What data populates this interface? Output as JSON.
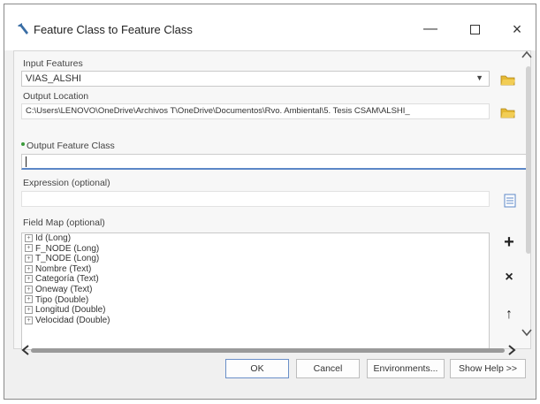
{
  "window": {
    "title": "Feature Class to Feature Class"
  },
  "title_buttons": {
    "minimize": "—",
    "close": "×"
  },
  "params": {
    "input_features": {
      "label": "Input Features",
      "value": "VIAS_ALSHI"
    },
    "output_location": {
      "label": "Output Location",
      "value": "C:\\Users\\LENOVO\\OneDrive\\Archivos T\\OneDrive\\Documentos\\Rvo. Ambiental\\5. Tesis CSAM\\ALSHI_"
    },
    "output_feature_class": {
      "label": "Output Feature Class",
      "value": ""
    },
    "expression": {
      "label": "Expression (optional)",
      "value": ""
    },
    "field_map": {
      "label": "Field Map (optional)",
      "items": [
        "Id (Long)",
        "F_NODE (Long)",
        "T_NODE (Long)",
        "Nombre (Text)",
        "Categoría (Text)",
        "Oneway (Text)",
        "Tipo (Double)",
        "Longitud (Double)",
        "Velocidad (Double)"
      ]
    }
  },
  "field_map_buttons": {
    "add": "+",
    "remove": "×",
    "up": "↑"
  },
  "footer": {
    "ok": "OK",
    "cancel": "Cancel",
    "environments": "Environments...",
    "show_help": "Show Help >>"
  },
  "icons": [
    "app-icon",
    "folder-icon",
    "sql-icon",
    "scroll-up-icon",
    "scroll-down-icon",
    "scroll-left-icon",
    "scroll-right-icon"
  ]
}
